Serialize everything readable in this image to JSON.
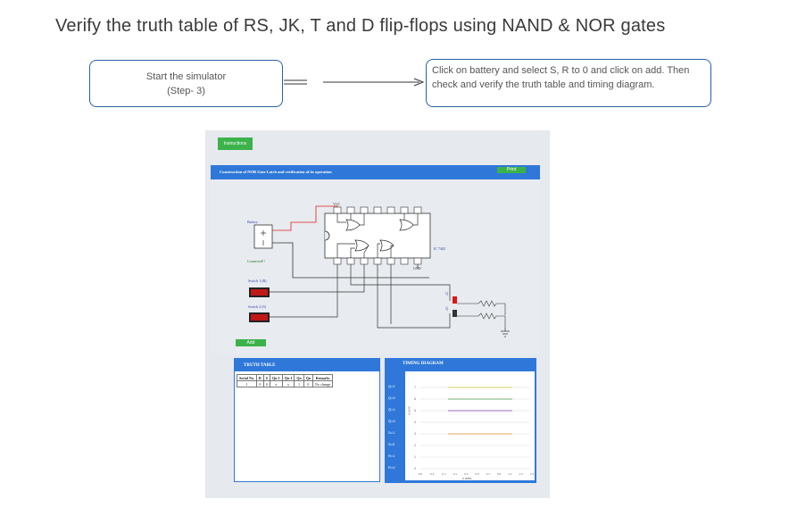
{
  "page": {
    "title": "Verify the truth table of RS, JK, T and D flip-flops using NAND & NOR gates"
  },
  "step_box": {
    "line1": "Start the simulator",
    "line2": "(Step- 3)"
  },
  "instruction_box": {
    "text": "Click on battery and select S, R to 0 and click on add. Then check and verify the truth table and timing diagram."
  },
  "simulator": {
    "instructions_button": "Instructions",
    "panel_title": "Construction of NOR Gate Latch and verification of its operation",
    "print_button": "Print",
    "battery_label": "Battery",
    "connected_label": "Connected!!",
    "switch1_label": "Switch 1 (R)",
    "switch2_label": "Switch 2 (S)",
    "add_button": "Add",
    "vcc_label": "VCC",
    "gnd_label": "GND",
    "ic_label": "IC 7402",
    "q_label": "Q",
    "qbar_label": "Q̄",
    "top_pins": [
      "14",
      "13",
      "12",
      "11",
      "10",
      "9",
      "8"
    ],
    "bottom_pins": [
      "1",
      "2",
      "3",
      "4",
      "5",
      "6",
      "7"
    ]
  },
  "truth_table": {
    "title": "TRUTH TABLE",
    "headers": [
      "Serial No.",
      "R",
      "S",
      "Qn-1",
      "Q̄n-1",
      "Qn",
      "Q̄n",
      "Remarks"
    ],
    "rows": [
      [
        "1",
        "0",
        "0",
        "x",
        "x",
        "1",
        "0",
        "No change"
      ]
    ]
  },
  "timing_diagram": {
    "title": "TIMING DIAGRAM",
    "row_labels": [
      "Q=1",
      "Q=0",
      "Q̄=1",
      "Q̄=0",
      "S=1",
      "S=0",
      "R=1",
      "R=0"
    ],
    "y_ticks": [
      "7",
      "6",
      "5",
      "4",
      "3",
      "2",
      "1",
      "0"
    ],
    "x_ticks": [
      "-0.5",
      "-0.4",
      "-0.1",
      "0.1",
      "0.3",
      "0.5",
      "0.7",
      "0.9",
      "1.1",
      "1.3",
      "1.5"
    ],
    "x_label": "x axis",
    "y_label": "y axis",
    "line_colors": [
      "#c9c43a",
      "#4a9a4a",
      "#7b3fa8",
      "#e08a2a"
    ]
  }
}
